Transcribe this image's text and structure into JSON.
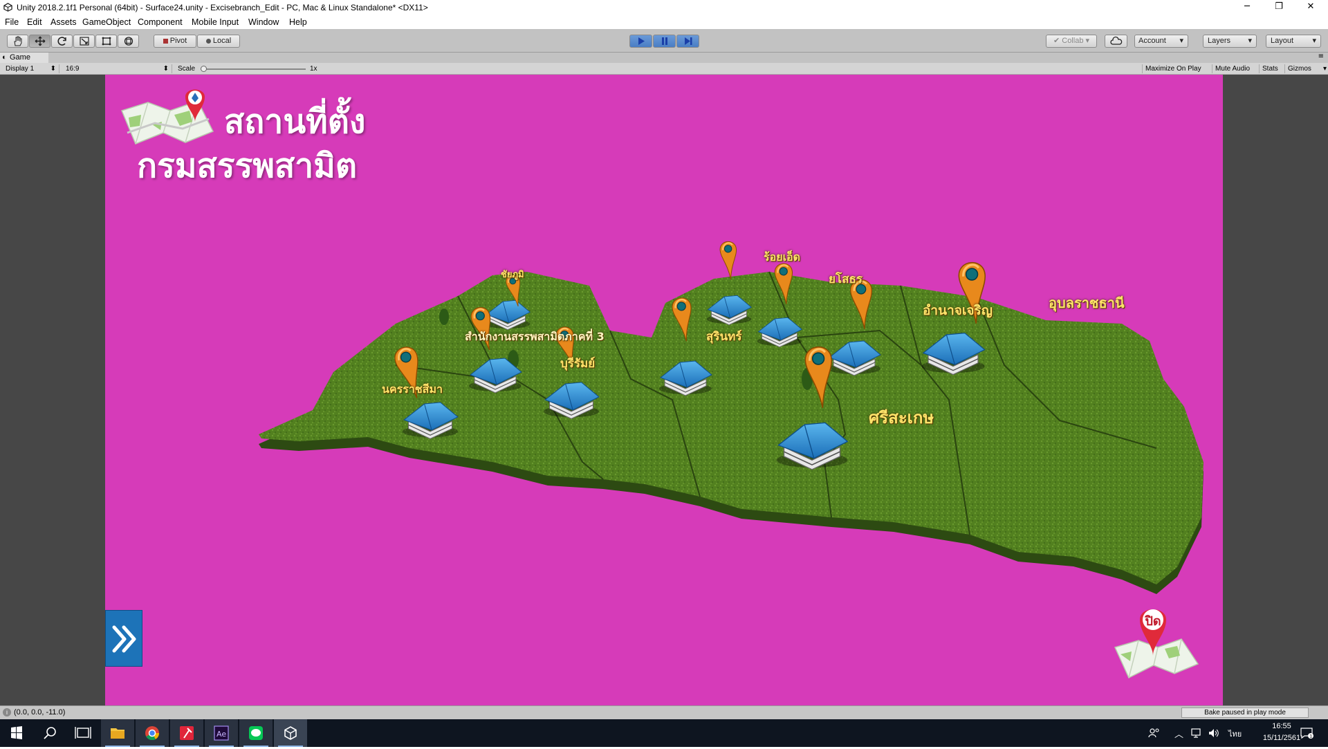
{
  "window": {
    "title": "Unity 2018.2.1f1 Personal (64bit) - Surface24.unity - Excisebranch_Edit - PC, Mac & Linux Standalone* <DX11>",
    "minimize": "─",
    "maximize": "❐",
    "close": "✕"
  },
  "menu": [
    "File",
    "Edit",
    "Assets",
    "GameObject",
    "Component",
    "Mobile Input",
    "Window",
    "Help"
  ],
  "toolbar": {
    "pivot": "Pivot",
    "local": "Local",
    "collab": "Collab",
    "account": "Account",
    "layers": "Layers",
    "layout": "Layout"
  },
  "game_view": {
    "tab": "Game",
    "display": "Display 1",
    "aspect": "16:9",
    "scale_label": "Scale",
    "scale_value": "1x",
    "scale_level": 0,
    "maximize_on_play": "Maximize On Play",
    "mute_audio": "Mute Audio",
    "stats": "Stats",
    "gizmos": "Gizmos"
  },
  "scene": {
    "title_line1": "สถานที่ตั้ง",
    "title_line2": "กรมสรรพสามิต",
    "close_label": "ปิด",
    "locations": [
      "ชัยภูมิ",
      "สำนักงานสรรพสามิตภาคที่ 3",
      "บุรีรัมย์",
      "นครราชสีมา",
      "ร้อยเอ็ด",
      "ยโสธร",
      "สุรินทร์",
      "อำนาจเจริญ",
      "อุบลราชธานี",
      "ศรีสะเกษ"
    ]
  },
  "status": {
    "coords": "(0.0, 0.0, -11.0)",
    "bake": "Bake paused in play mode"
  },
  "taskbar": {
    "lang": "ไทย",
    "time": "16:55",
    "date": "15/11/2561"
  },
  "colors": {
    "game_background": "#d63bb9",
    "map_green": "#4f7a22",
    "label_yellow": "#ffe36a",
    "pin_orange": "#e8891c"
  }
}
